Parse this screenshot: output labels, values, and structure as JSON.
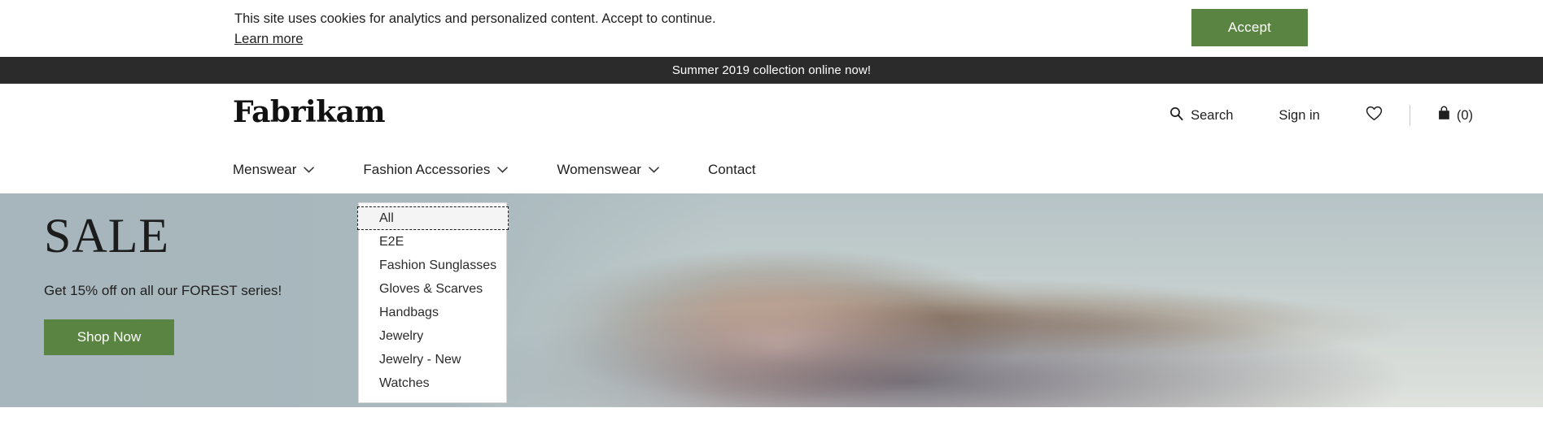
{
  "cookie_bar": {
    "message": "This site uses cookies for analytics and personalized content. Accept to continue.",
    "learn_more_label": "Learn more",
    "accept_label": "Accept",
    "accent_color": "#5a8442"
  },
  "promo": {
    "text": "Summer 2019 collection online now!",
    "background_color": "#2b2b2b"
  },
  "header": {
    "brand": "Fabrikam",
    "search_label": "Search",
    "search_icon": "search-icon",
    "signin_label": "Sign in",
    "wishlist_icon": "heart-icon",
    "bag_icon": "shopping-bag-icon",
    "bag_count_label": "(0)"
  },
  "nav": {
    "items": [
      {
        "label": "Menswear",
        "has_dropdown": true,
        "icon": "chevron-down-icon"
      },
      {
        "label": "Fashion Accessories",
        "has_dropdown": true,
        "icon": "chevron-down-icon"
      },
      {
        "label": "Womenswear",
        "has_dropdown": true,
        "icon": "chevron-down-icon"
      },
      {
        "label": "Contact",
        "has_dropdown": false,
        "icon": ""
      }
    ]
  },
  "dropdown": {
    "parent": "Fashion Accessories",
    "items": [
      {
        "label": "All",
        "focused": true
      },
      {
        "label": "E2E",
        "focused": false
      },
      {
        "label": "Fashion Sunglasses",
        "focused": false
      },
      {
        "label": "Gloves & Scarves",
        "focused": false
      },
      {
        "label": "Handbags",
        "focused": false
      },
      {
        "label": "Jewelry",
        "focused": false
      },
      {
        "label": "Jewelry - New",
        "focused": false
      },
      {
        "label": "Watches",
        "focused": false
      }
    ]
  },
  "hero": {
    "title": "SALE",
    "subtitle": "Get 15% off on all our FOREST series!",
    "cta_label": "Shop Now",
    "cta_color": "#5a8442",
    "background_color": "#a7b7bd",
    "image_alt": "woman-with-windblown-hair"
  }
}
